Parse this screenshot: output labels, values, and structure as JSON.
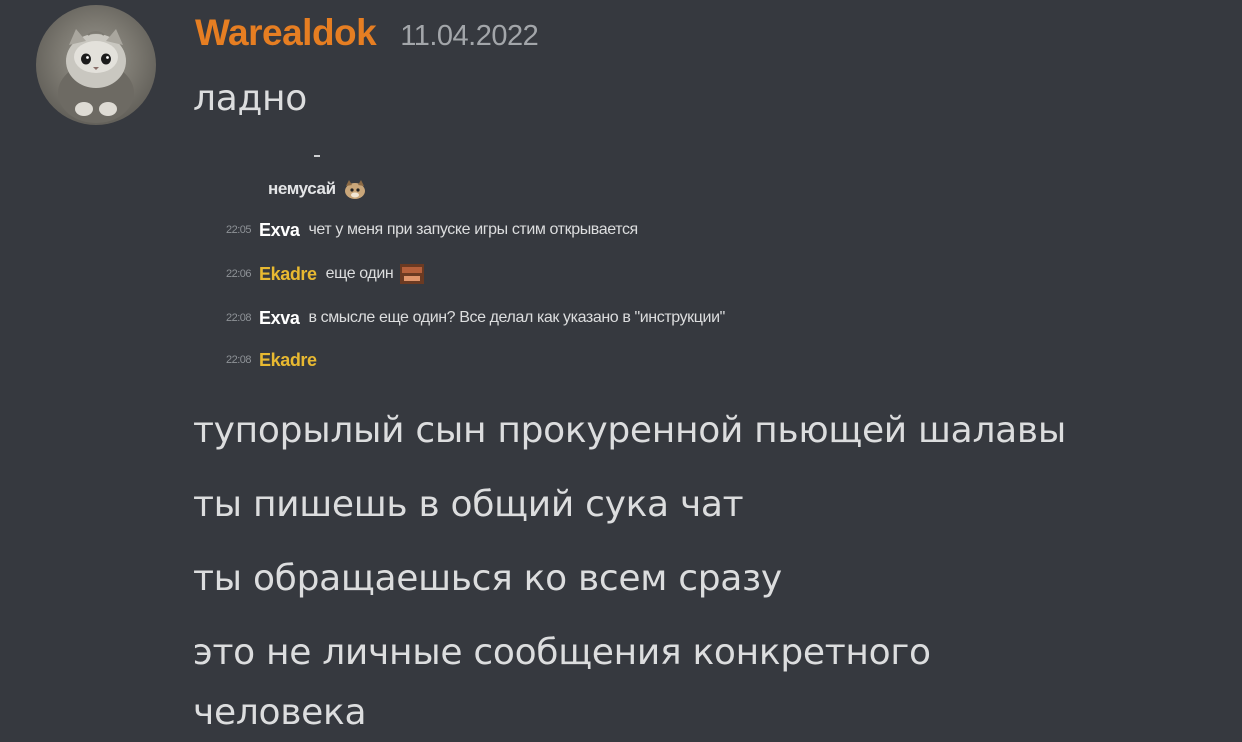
{
  "message": {
    "author": "Warealdok",
    "timestamp": "11.04.2022",
    "author_color": "#e67e22",
    "first_line": "ладно",
    "lines": [
      "тупорылый сын прокуренной пьющей шалавы",
      "ты пишешь в общий сука чат",
      "ты обращаешься ко всем сразу",
      "это не личные сообщения конкретного",
      "человека"
    ]
  },
  "attachment": {
    "header_text": "немусай",
    "rows": [
      {
        "time": "22:05",
        "name": "Exva",
        "name_color": "#ffffff",
        "text": "чет у меня при запуске игры стим открывается"
      },
      {
        "time": "22:06",
        "name": "Ekadre",
        "name_color": "#e8b931",
        "text": "еще один"
      },
      {
        "time": "22:08",
        "name": "Exva",
        "name_color": "#ffffff",
        "text": "в смысле еще один? Все делал как указано в \"инструкции\""
      },
      {
        "time": "22:08",
        "name": "Ekadre",
        "name_color": "#e8b931",
        "text": ""
      }
    ]
  },
  "colors": {
    "background": "#36393f",
    "text": "#dcddde",
    "muted": "#a3a6aa"
  }
}
